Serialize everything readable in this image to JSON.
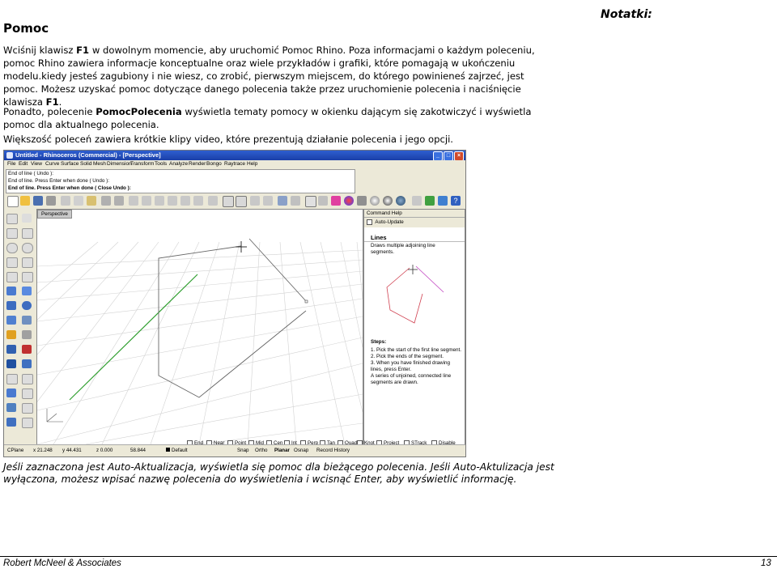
{
  "page": {
    "title": "Pomoc",
    "notes_label": "Notatki:",
    "para1_pre": "Wciśnij klawisz ",
    "para1_key": "F1",
    "para1_post": " w dowolnym momencie, aby uruchomić Pomoc Rhino. Poza informacjami o każdym poleceniu, pomoc Rhino zawiera informacje konceptualne oraz wiele przykładów i grafiki, które pomagają w ukończeniu modelu.kiedy jesteś zagubiony i nie wiesz, co zrobić, pierwszym miejscem, do którego powinieneś zajrzeć, jest pomoc. Możesz uzyskać pomoc dotyczące danego polecenia także przez uruchomienie polecenia i naciśnięcie klawisza ",
    "para1_key2": "F1",
    "para1_end": ".",
    "para2_pre": "Ponadto, polecenie ",
    "para2_cmd": "PomocPolecenia",
    "para2_post": " wyświetla tematy pomocy w okienku dającym się zakotwiczyć i wyświetla pomoc dla aktualnego polecenia.",
    "para3": "Większość poleceń zawiera krótkie klipy video, które prezentują działanie polecenia i jego opcji.",
    "caption": "Jeśli zaznaczona jest Auto-Aktualizacja, wyświetla się pomoc dla bieżącego polecenia. Jeśli Auto-Aktulizacja jest wyłączona, możesz wpisać nazwę polecenia do wyświetlenia i wcisnąć Enter, aby wyświetlić informację.",
    "footer_left": "Robert McNeel & Associates",
    "footer_right": "13"
  },
  "rhino": {
    "window_title": "Untitled - Rhinoceros (Commercial) - [Perspective]",
    "menu": [
      "File",
      "Edit",
      "View",
      "Curve",
      "Surface",
      "Solid",
      "Mesh",
      "Dimension",
      "Transform",
      "Tools",
      "Analyze",
      "Render",
      "Bongo",
      "Raytrace",
      "Help"
    ],
    "command_history": [
      "End of line ( Undo ):",
      "End of line. Press Enter when done ( Undo ):"
    ],
    "command_prompt": "End of line. Press Enter when done ( Close  Undo ):",
    "viewport_label": "Perspective",
    "help_panel": {
      "header": "Command Help",
      "auto_update": "Auto-Update",
      "cmd_title": "Lines",
      "cmd_desc": "Draws multiple adjoining line segments.",
      "steps_title": "Steps:",
      "steps": [
        "1. Pick the start of the first line segment.",
        "2. Pick the ends of the segment.",
        "3. When you have finished drawing lines, press Enter.",
        "A series of unjoined, connected line segments are drawn."
      ]
    },
    "osnaps": [
      "End",
      "Near",
      "Point",
      "Mid",
      "Cen",
      "Int",
      "Perp",
      "Tan",
      "Quad",
      "Knot",
      "Project",
      "STrack",
      "Disable"
    ],
    "status": {
      "cplane": "CPlane",
      "x": "x 21.248",
      "y": "y 44.431",
      "z": "z 0.000",
      "dist": "58.844",
      "layer": "Default",
      "snap": "Snap",
      "ortho": "Ortho",
      "planar": "Planar",
      "osnap": "Osnap",
      "history": "Record History"
    }
  }
}
